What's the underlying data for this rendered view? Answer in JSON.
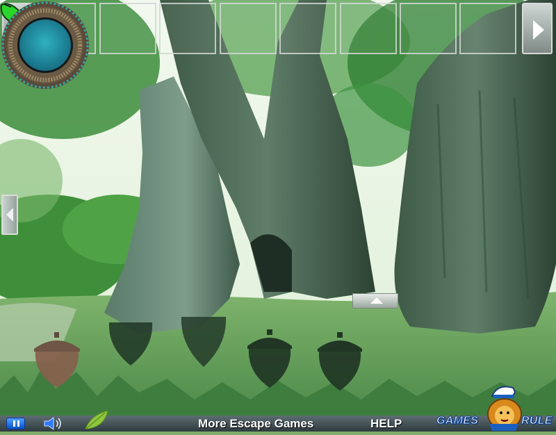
{
  "game": {
    "inventory": {
      "slot_count": 8,
      "prev_icon": "left-arrow-icon",
      "next_icon": "right-arrow-icon"
    },
    "scene": {
      "description_items": [
        "tree",
        "butterfly",
        "round-portal",
        "acorn-silhouettes"
      ],
      "acorn_slots": [
        {
          "state": "filled"
        },
        {
          "state": "empty"
        },
        {
          "state": "empty"
        },
        {
          "state": "empty"
        },
        {
          "state": "empty"
        }
      ],
      "portal_color": "#1e8a9a",
      "butterfly_color": "#2bd62b"
    },
    "bottom_bar": {
      "more_games_label": "More Escape Games",
      "help_label": "HELP",
      "pause_icon": "pause-icon",
      "sound_icon": "speaker-icon",
      "leaf_icon": "leaf-icon"
    },
    "logo": {
      "left_word": "GAMES",
      "right_word": "RULE"
    }
  }
}
